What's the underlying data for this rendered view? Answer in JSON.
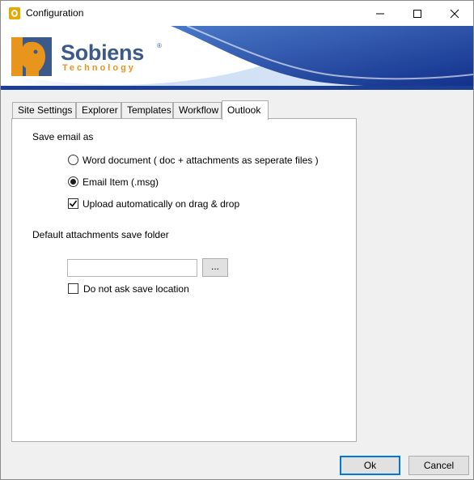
{
  "window": {
    "title": "Configuration"
  },
  "banner": {
    "brand_name": "Sobiens",
    "brand_reg": "®",
    "brand_sub": "Technology"
  },
  "tabs": [
    {
      "label": "Site Settings",
      "active": false
    },
    {
      "label": "Explorer",
      "active": false
    },
    {
      "label": "Templates",
      "active": false
    },
    {
      "label": "Workflow",
      "active": false
    },
    {
      "label": "Outlook",
      "active": true
    }
  ],
  "outlook": {
    "save_email_as_label": "Save email as",
    "option_word": "Word document ( doc + attachments as seperate files )",
    "option_msg": "Email Item (.msg)",
    "selected_option": "Email Item (.msg)",
    "upload_auto_label": "Upload automatically on drag & drop",
    "upload_auto_checked": true,
    "default_folder_label": "Default attachments save folder",
    "folder_value": "",
    "browse_label": "...",
    "do_not_ask_label": "Do not ask save location",
    "do_not_ask_checked": false
  },
  "footer": {
    "ok_label": "Ok",
    "cancel_label": "Cancel"
  },
  "colors": {
    "brand_blue": "#3b5a8a",
    "brand_orange": "#e8951e",
    "banner_wave_dark": "#1c3f94",
    "default_button_border": "#0078d7"
  }
}
